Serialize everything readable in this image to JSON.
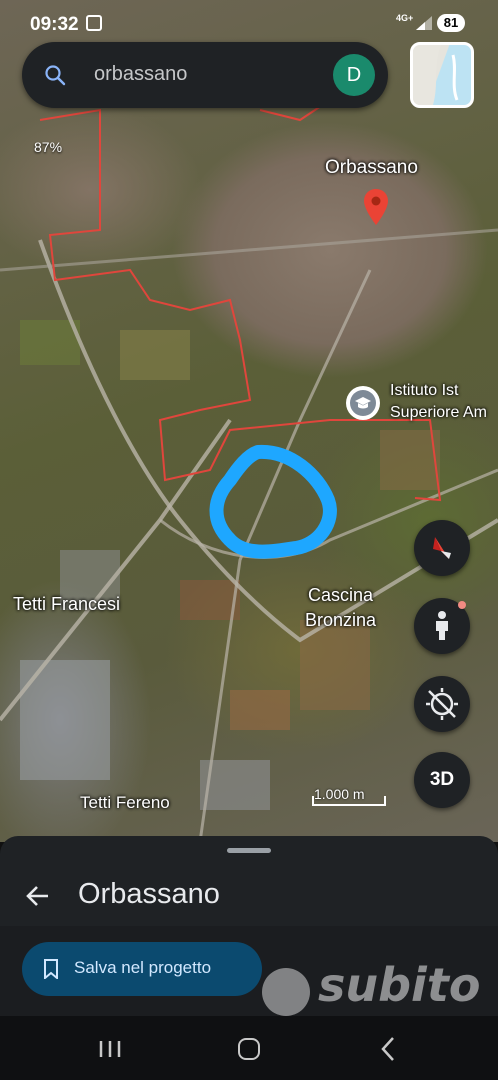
{
  "status_bar": {
    "time": "09:32",
    "network": "4G+",
    "battery": "81"
  },
  "search": {
    "query": "orbassano",
    "avatar_letter": "D"
  },
  "map": {
    "tilt_percent": "87%",
    "labels": {
      "town": "Orbassano",
      "school_line1": "Istituto Ist",
      "school_line2": "Superiore Am",
      "tetti_francesi": "Tetti Francesi",
      "cascina_line1": "Cascina",
      "cascina_line2": "Bronzina",
      "tetti_fereno": "Tetti Fereno"
    },
    "scale": "1.000 m",
    "view_3d_label": "3D",
    "highlight_color": "#1ea7ff",
    "boundary_color": "#e0463c"
  },
  "sheet": {
    "title": "Orbassano",
    "save_button": "Salva nel progetto"
  },
  "watermark": "subito",
  "icons": [
    "search-icon",
    "layers-icon",
    "pin-icon",
    "school-icon",
    "compass-icon",
    "pegman-icon",
    "location-off-icon",
    "back-arrow-icon",
    "bookmark-icon",
    "recents-icon",
    "home-icon",
    "nav-back-icon"
  ]
}
